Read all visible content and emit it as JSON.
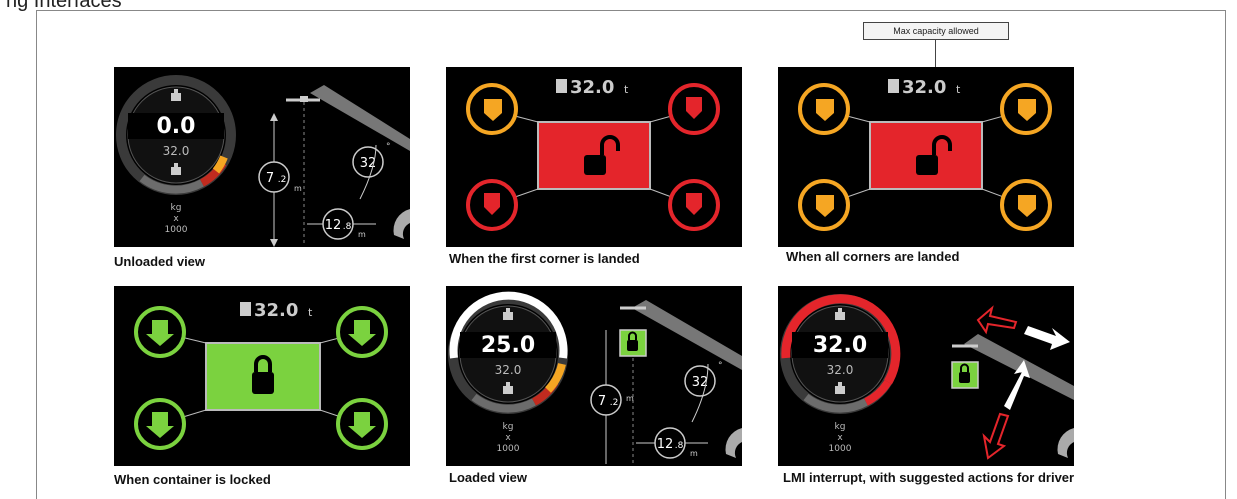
{
  "header": {
    "title": "ng Interfaces"
  },
  "callout": {
    "text": "Max capacity allowed"
  },
  "panels": {
    "unloaded": {
      "caption": "Unloaded view",
      "load": "0.0",
      "capacity": "32.0",
      "unit": [
        "kg",
        "x",
        "1000"
      ],
      "height": "7",
      "height_dec": ".2",
      "height_unit": "m",
      "angle": "32",
      "angle_unit": "°",
      "reach": "12",
      "reach_dec": ".8",
      "reach_unit": "m"
    },
    "first_corner": {
      "caption": "When the first corner is landed",
      "weight": "32.0",
      "weight_unit": "t"
    },
    "all_corners": {
      "caption": "When all corners are landed",
      "weight": "32.0",
      "weight_unit": "t"
    },
    "locked": {
      "caption": "When container is locked",
      "weight": "32.0",
      "weight_unit": "t"
    },
    "loaded": {
      "caption": "Loaded view",
      "load": "25.0",
      "capacity": "32.0",
      "unit": [
        "kg",
        "x",
        "1000"
      ],
      "height": "7",
      "height_dec": ".2",
      "height_unit": "m",
      "angle": "32",
      "angle_unit": "°",
      "reach": "12",
      "reach_dec": ".8",
      "reach_unit": "m"
    },
    "lmi": {
      "caption": "LMI interrupt, with suggested actions for driver",
      "load": "32.0",
      "capacity": "32.0",
      "unit": [
        "kg",
        "x",
        "1000"
      ]
    }
  },
  "colors": {
    "orange": "#f5a623",
    "red": "#e4252b",
    "green": "#7bd23f",
    "grey": "#9a9a9a"
  }
}
